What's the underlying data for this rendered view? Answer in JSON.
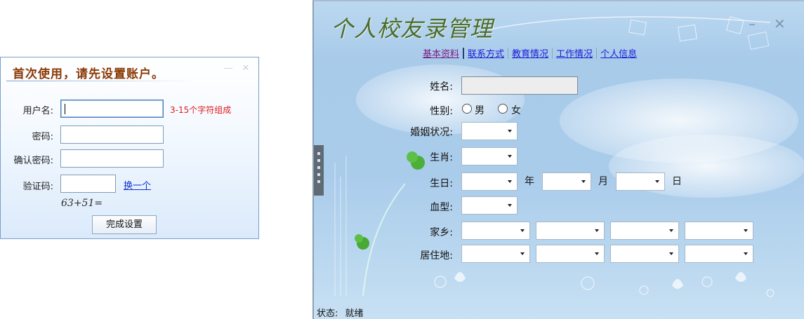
{
  "setup": {
    "title": "首次使用，请先设置账户。",
    "fields": {
      "username_label": "用户名:",
      "username_hint": "3-15个字符组成",
      "password_label": "密码:",
      "confirm_label": "确认密码:",
      "captcha_label": "验证码:",
      "refresh_link": "换一个",
      "captcha_question": "63+51="
    },
    "submit": "完成设置"
  },
  "manager": {
    "title": "个人校友录管理",
    "tabs": [
      "基本资料",
      "联系方式",
      "教育情况",
      "工作情况",
      "个人信息"
    ],
    "active_tab": 0,
    "fields": {
      "name": "姓名:",
      "gender": "性别:",
      "gender_options": [
        "男",
        "女"
      ],
      "marital": "婚姻状况:",
      "zodiac": "生肖:",
      "birthday": "生日:",
      "year": "年",
      "month": "月",
      "day": "日",
      "blood": "血型:",
      "hometown": "家乡:",
      "residence": "居住地:"
    },
    "status_label": "状态:",
    "status_value": "就绪"
  }
}
